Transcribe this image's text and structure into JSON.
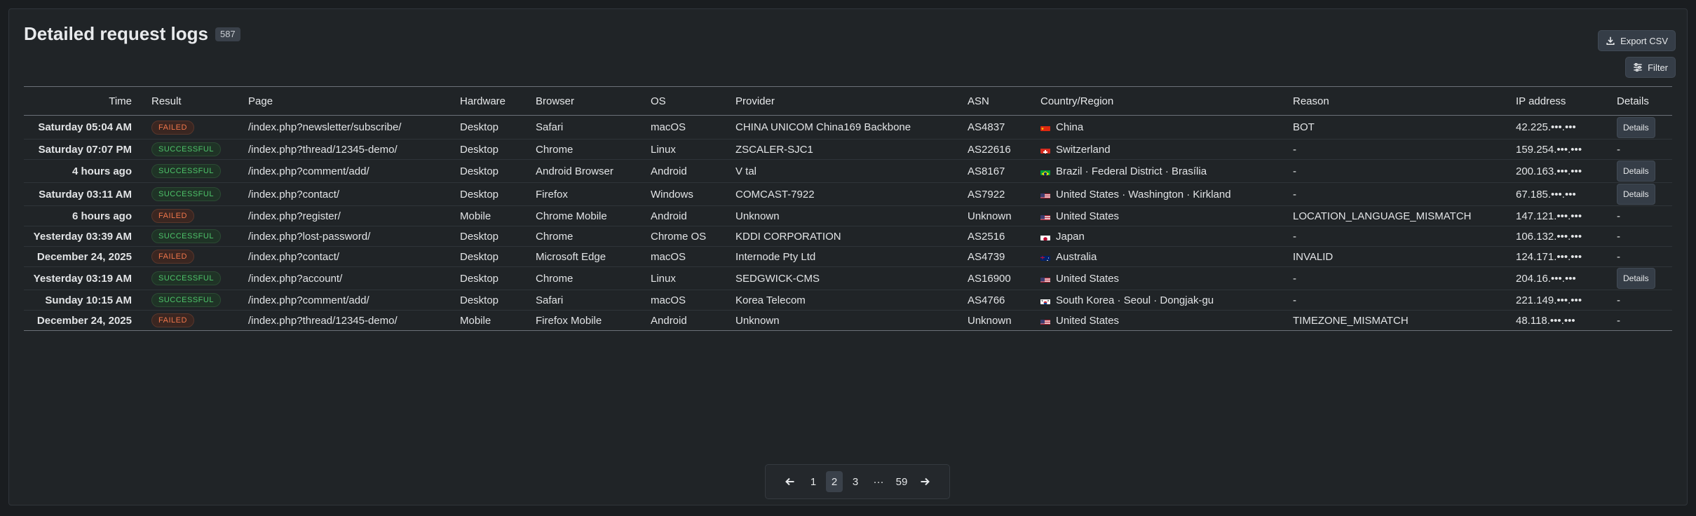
{
  "header": {
    "title": "Detailed request logs",
    "count": "587"
  },
  "toolbar": {
    "export_label": "Export CSV",
    "filter_label": "Filter"
  },
  "columns": [
    "Time",
    "Result",
    "Page",
    "Hardware",
    "Browser",
    "OS",
    "Provider",
    "ASN",
    "Country/Region",
    "Reason",
    "IP address",
    "Details"
  ],
  "rows": [
    {
      "time": "Saturday 05:04 AM",
      "result": "FAILED",
      "page": "/index.php?newsletter/subscribe/",
      "hardware": "Desktop",
      "browser": "Safari",
      "os": "macOS",
      "provider": "CHINA UNICOM China169 Backbone",
      "asn": "AS4837",
      "country": "China",
      "flag": "cn",
      "reason": "BOT",
      "ip": "42.225.•••.•••",
      "details": "Details"
    },
    {
      "time": "Saturday 07:07 PM",
      "result": "SUCCESSFUL",
      "page": "/index.php?thread/12345-demo/",
      "hardware": "Desktop",
      "browser": "Chrome",
      "os": "Linux",
      "provider": "ZSCALER-SJC1",
      "asn": "AS22616",
      "country": "Switzerland",
      "flag": "ch",
      "reason": "-",
      "ip": "159.254.•••.•••",
      "details": "-"
    },
    {
      "time": "4 hours ago",
      "result": "SUCCESSFUL",
      "page": "/index.php?comment/add/",
      "hardware": "Desktop",
      "browser": "Android Browser",
      "os": "Android",
      "provider": "V tal",
      "asn": "AS8167",
      "country": "Brazil · Federal District · Brasília",
      "flag": "br",
      "reason": "-",
      "ip": "200.163.•••.•••",
      "details": "Details"
    },
    {
      "time": "Saturday 03:11 AM",
      "result": "SUCCESSFUL",
      "page": "/index.php?contact/",
      "hardware": "Desktop",
      "browser": "Firefox",
      "os": "Windows",
      "provider": "COMCAST-7922",
      "asn": "AS7922",
      "country": "United States · Washington · Kirkland",
      "flag": "us",
      "reason": "-",
      "ip": "67.185.•••.•••",
      "details": "Details"
    },
    {
      "time": "6 hours ago",
      "result": "FAILED",
      "page": "/index.php?register/",
      "hardware": "Mobile",
      "browser": "Chrome Mobile",
      "os": "Android",
      "provider": "Unknown",
      "asn": "Unknown",
      "country": "United States",
      "flag": "us",
      "reason": "LOCATION_LANGUAGE_MISMATCH",
      "ip": "147.121.•••.•••",
      "details": "-"
    },
    {
      "time": "Yesterday 03:39 AM",
      "result": "SUCCESSFUL",
      "page": "/index.php?lost-password/",
      "hardware": "Desktop",
      "browser": "Chrome",
      "os": "Chrome OS",
      "provider": "KDDI CORPORATION",
      "asn": "AS2516",
      "country": "Japan",
      "flag": "jp",
      "reason": "-",
      "ip": "106.132.•••.•••",
      "details": "-"
    },
    {
      "time": "December 24, 2025",
      "result": "FAILED",
      "page": "/index.php?contact/",
      "hardware": "Desktop",
      "browser": "Microsoft Edge",
      "os": "macOS",
      "provider": "Internode Pty Ltd",
      "asn": "AS4739",
      "country": "Australia",
      "flag": "au",
      "reason": "INVALID",
      "ip": "124.171.•••.•••",
      "details": "-"
    },
    {
      "time": "Yesterday 03:19 AM",
      "result": "SUCCESSFUL",
      "page": "/index.php?account/",
      "hardware": "Desktop",
      "browser": "Chrome",
      "os": "Linux",
      "provider": "SEDGWICK-CMS",
      "asn": "AS16900",
      "country": "United States",
      "flag": "us",
      "reason": "-",
      "ip": "204.16.•••.•••",
      "details": "Details"
    },
    {
      "time": "Sunday 10:15 AM",
      "result": "SUCCESSFUL",
      "page": "/index.php?comment/add/",
      "hardware": "Desktop",
      "browser": "Safari",
      "os": "macOS",
      "provider": "Korea Telecom",
      "asn": "AS4766",
      "country": "South Korea · Seoul · Dongjak-gu",
      "flag": "kr",
      "reason": "-",
      "ip": "221.149.•••.•••",
      "details": "-"
    },
    {
      "time": "December 24, 2025",
      "result": "FAILED",
      "page": "/index.php?thread/12345-demo/",
      "hardware": "Mobile",
      "browser": "Firefox Mobile",
      "os": "Android",
      "provider": "Unknown",
      "asn": "Unknown",
      "country": "United States",
      "flag": "us",
      "reason": "TIMEZONE_MISMATCH",
      "ip": "48.118.•••.•••",
      "details": "-"
    }
  ],
  "pagination": {
    "pages": [
      "1",
      "2",
      "3",
      "···",
      "59"
    ],
    "current": "2"
  },
  "icons": {
    "export": "download-icon",
    "filter": "sliders-icon",
    "prev": "arrow-left-icon",
    "next": "arrow-right-icon"
  },
  "colors": {
    "failed": "#f0764a",
    "successful": "#4ec46a",
    "panel": "#202427",
    "background": "#1a1d20"
  }
}
